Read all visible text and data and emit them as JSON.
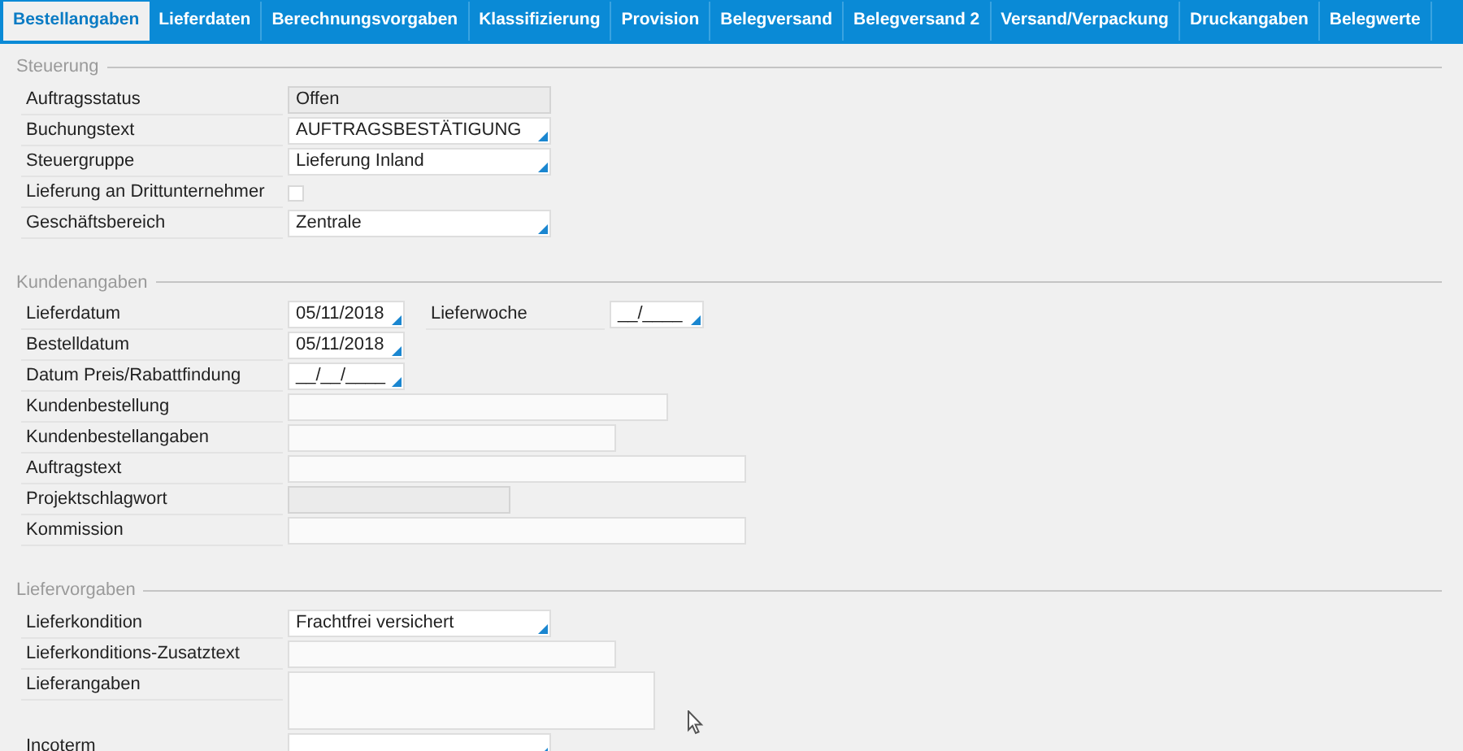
{
  "tabs": [
    {
      "label": "Bestellangaben",
      "selected": true
    },
    {
      "label": "Lieferdaten",
      "selected": false
    },
    {
      "label": "Berechnungsvorgaben",
      "selected": false
    },
    {
      "label": "Klassifizierung",
      "selected": false
    },
    {
      "label": "Provision",
      "selected": false
    },
    {
      "label": "Belegversand",
      "selected": false
    },
    {
      "label": "Belegversand 2",
      "selected": false
    },
    {
      "label": "Versand/Verpackung",
      "selected": false
    },
    {
      "label": "Druckangaben",
      "selected": false
    },
    {
      "label": "Belegwerte",
      "selected": false
    }
  ],
  "sections": [
    {
      "legend": "Steuerung",
      "rows": [
        {
          "label": "Auftragsstatus",
          "kind": "readonly",
          "value": "Offen"
        },
        {
          "label": "Buchungstext",
          "kind": "dropdown",
          "value": "AUFTRAGSBESTÄTIGUNG"
        },
        {
          "label": "Steuergruppe",
          "kind": "dropdown",
          "value": "Lieferung Inland"
        },
        {
          "label": "Lieferung an Drittunternehmer",
          "kind": "checkbox",
          "checked": false
        },
        {
          "label": "Geschäftsbereich",
          "kind": "dropdown",
          "value": "Zentrale"
        }
      ]
    },
    {
      "legend": "Kundenangaben",
      "rows": [
        {
          "label": "Lieferdatum",
          "kind": "date",
          "value": "05/11/2018",
          "extra": {
            "label": "Lieferwoche",
            "kind": "date",
            "value": "__/____"
          }
        },
        {
          "label": "Bestelldatum",
          "kind": "date",
          "value": "05/11/2018"
        },
        {
          "label": "Datum Preis/Rabattfindung",
          "kind": "date",
          "value": "__/__/____"
        },
        {
          "label": "Kundenbestellung",
          "kind": "text"
        },
        {
          "label": "Kundenbestellangaben",
          "kind": "text"
        },
        {
          "label": "Auftragstext",
          "kind": "text"
        },
        {
          "label": "Projektschlagwort",
          "kind": "readonly"
        },
        {
          "label": "Kommission",
          "kind": "text"
        }
      ]
    },
    {
      "legend": "Liefervorgaben",
      "rows": [
        {
          "label": "Lieferkondition",
          "kind": "dropdown",
          "value": "Frachtfrei versichert"
        },
        {
          "label": "Lieferkonditions-Zusatztext",
          "kind": "text"
        },
        {
          "label": "Lieferangaben",
          "kind": "textarea"
        },
        {
          "label": "Incoterm",
          "kind": "dropdown"
        }
      ]
    }
  ]
}
